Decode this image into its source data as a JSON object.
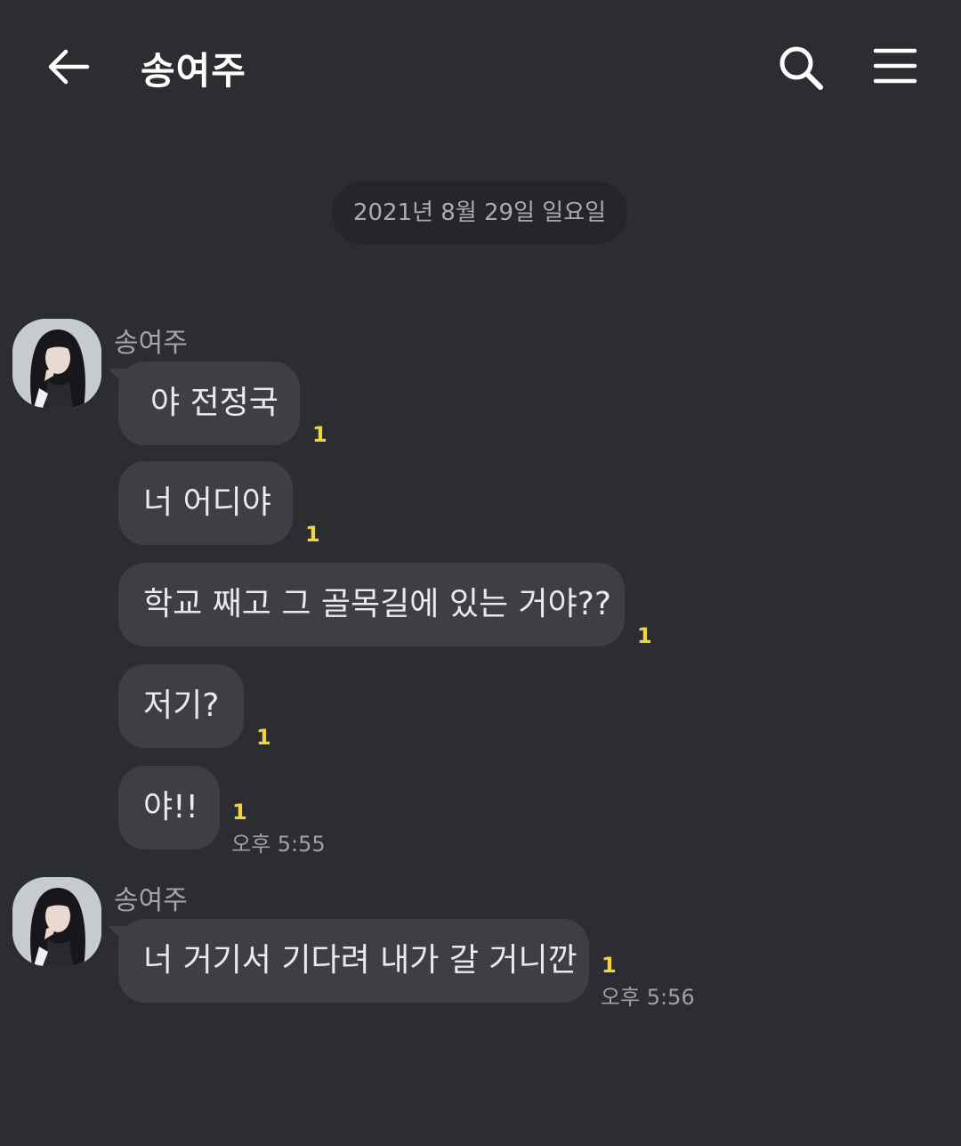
{
  "header": {
    "back_icon": "arrow-left-icon",
    "title": "송여주",
    "search_icon": "search-icon",
    "menu_icon": "menu-icon"
  },
  "chat": {
    "date_divider": "2021년 8월 29일 일요일",
    "groups": [
      {
        "sender": "송여주",
        "messages": [
          {
            "text": "야 전정국",
            "unread": "1"
          },
          {
            "text": "너 어디야",
            "unread": "1"
          },
          {
            "text": "학교 째고 그 골목길에 있는 거야??",
            "unread": "1"
          },
          {
            "text": "저기?",
            "unread": "1"
          },
          {
            "text": "야!!",
            "unread": "1",
            "time": "오후 5:55"
          }
        ]
      },
      {
        "sender": "송여주",
        "messages": [
          {
            "text": "너 거기서 기다려 내가 갈 거니깐",
            "unread": "1",
            "time": "오후 5:56"
          }
        ]
      }
    ]
  },
  "colors": {
    "background": "#2b2d31",
    "bubble": "#3d3f44",
    "unread_count": "#f2d53c"
  }
}
